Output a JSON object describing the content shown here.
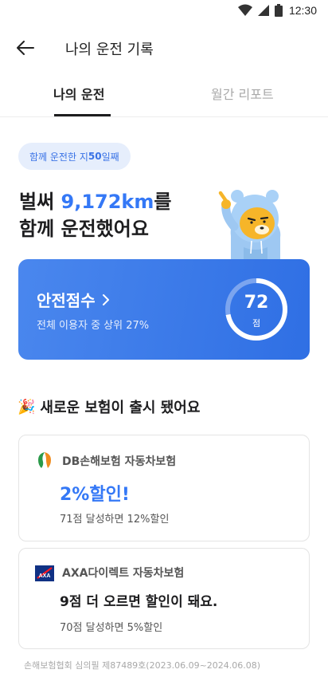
{
  "status_bar": {
    "time": "12:30"
  },
  "app_bar": {
    "title": "나의 운전 기록"
  },
  "tabs": [
    {
      "label": "나의 운전",
      "active": true
    },
    {
      "label": "월간 리포트",
      "active": false
    }
  ],
  "days_pill": {
    "prefix": "함께 운전한 지 ",
    "days": "50",
    "suffix": "일째"
  },
  "headline": {
    "line1_prefix": "벌써 ",
    "distance": "9,172km",
    "line1_suffix": "를",
    "line2": "함께 운전했어요"
  },
  "score_card": {
    "title": "안전점수",
    "subtitle": "전체 이용자 중 상위 27%",
    "score": "72",
    "score_max": 100,
    "unit": "점"
  },
  "section": {
    "emoji": "🎉",
    "title": "새로운 보험이 출시 됐어요"
  },
  "insurance": [
    {
      "name": "DB손해보험 자동차보험",
      "benefit": "2%할인!",
      "condition": "71점 달성하면 12%할인",
      "logo": "db-logo-icon"
    },
    {
      "name": "AXA다이렉트 자동차보험",
      "benefit": "9점 더 오르면 할인이 돼요.",
      "condition": "70점 달성하면 5%할인",
      "logo": "axa-logo-icon"
    }
  ],
  "footnote": "손해보험협회 심의필 제87489호(2023.06.09~2024.06.08)",
  "colors": {
    "accent": "#3478f6",
    "card_start": "#4a87ee",
    "card_end": "#2f6fe4"
  }
}
